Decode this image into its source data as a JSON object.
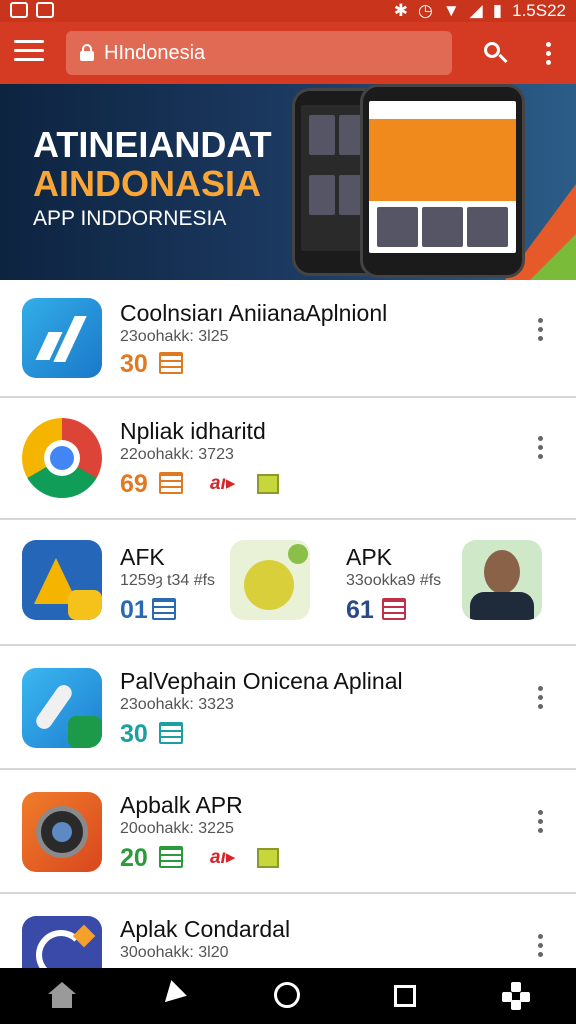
{
  "status": {
    "time": "1.5S22",
    "icons": [
      "bluetooth-icon",
      "alarm-icon",
      "wifi-icon",
      "signal-icon",
      "battery-icon"
    ]
  },
  "toolbar": {
    "url": "HIndonesia"
  },
  "banner": {
    "line1": "ATINEIANDAT",
    "line2": "AINDONASIA",
    "line3": "APP INDDORNESIA"
  },
  "apps": [
    {
      "title": "Coolnsiarı AniianaAplnionl",
      "sub": "23oohakk: 3l25",
      "num": "30",
      "num_color": "#e07a22"
    },
    {
      "title": "Npliak idharitd",
      "sub": "22oohakk: 3723",
      "num": "69",
      "num_color": "#e07a22",
      "badge": "aı▸"
    },
    {
      "title": "AFK",
      "sub": "1259ȝ t34 #fs",
      "num": "01",
      "num_color": "#2a6ab3",
      "title2": "APK",
      "sub2": "33ookka9 #fs",
      "num2": "61",
      "num2_color": "#2a4a8a"
    },
    {
      "title": "PalVephain Onicena Aplinal",
      "sub": "23oohakk: 3323",
      "num": "30",
      "num_color": "#1aa0a0"
    },
    {
      "title": "Apbalk APR",
      "sub": "20oohakk: 3225",
      "num": "20",
      "num_color": "#2a9a3a",
      "badge": "aı▸"
    },
    {
      "title": "Aplak Condardal",
      "sub": "30oohakk: 3l20",
      "num": "",
      "num_color": "#333"
    }
  ]
}
